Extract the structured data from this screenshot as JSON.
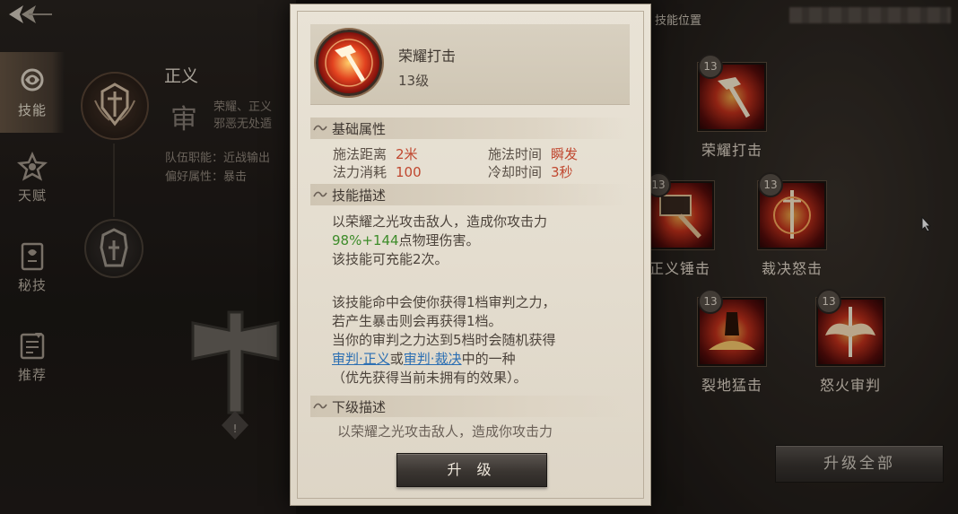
{
  "nav": [
    {
      "label": "技能",
      "icon": "skill-icon",
      "active": true
    },
    {
      "label": "天赋",
      "icon": "talent-icon",
      "active": false
    },
    {
      "label": "秘技",
      "icon": "secret-book-icon",
      "active": false
    },
    {
      "label": "推荐",
      "icon": "recommend-icon",
      "active": false
    }
  ],
  "class_panel": {
    "name": "正义",
    "glyph": "审",
    "desc_lines": [
      "荣耀、正义",
      "邪恶无处遁"
    ],
    "attrs": [
      "队伍职能：近战输出",
      "偏好属性：暴击"
    ]
  },
  "skill_popup": {
    "name": "荣耀打击",
    "level": "13级",
    "base_section": "基础属性",
    "attrs": [
      {
        "key": "施法距离",
        "value": "2米"
      },
      {
        "key": "施法时间",
        "value": "瞬发"
      },
      {
        "key": "法力消耗",
        "value": "100"
      },
      {
        "key": "冷却时间",
        "value": "3秒"
      }
    ],
    "desc_section": "技能描述",
    "desc": {
      "l1": "以荣耀之光攻击敌人，造成你攻击力",
      "l2_green": "98%+144",
      "l2_rest": "点物理伤害。",
      "l3": "该技能可充能2次。",
      "l4": "该技能命中会使你获得1档审判之力，",
      "l5": "若产生暴击则会再获得1档。",
      "l6": "当你的审判之力达到5档时会随机获得",
      "l7_link1": "审判·正义",
      "l7_or": "或",
      "l7_link2": "审判·裁决",
      "l7_rest": "中的一种",
      "l8": "（优先获得当前未拥有的效果）。"
    },
    "next_section": "下级描述",
    "next_desc": "以荣耀之光攻击敌人，造成你攻击力",
    "upgrade_label": "升 级"
  },
  "skill_grid": {
    "title": "技能位置",
    "skills": [
      {
        "name": "荣耀打击",
        "level": "13"
      },
      {
        "name": "正义锤击",
        "level": "13"
      },
      {
        "name": "裁决怒击",
        "level": "13"
      },
      {
        "name": "裂地猛击",
        "level": "13"
      },
      {
        "name": "怒火审判",
        "level": "13"
      }
    ],
    "upgrade_all_label": "升级全部"
  },
  "colors": {
    "accent_red": "#c0472f",
    "green": "#3d8c2a",
    "link_blue": "#2c6fb3"
  }
}
